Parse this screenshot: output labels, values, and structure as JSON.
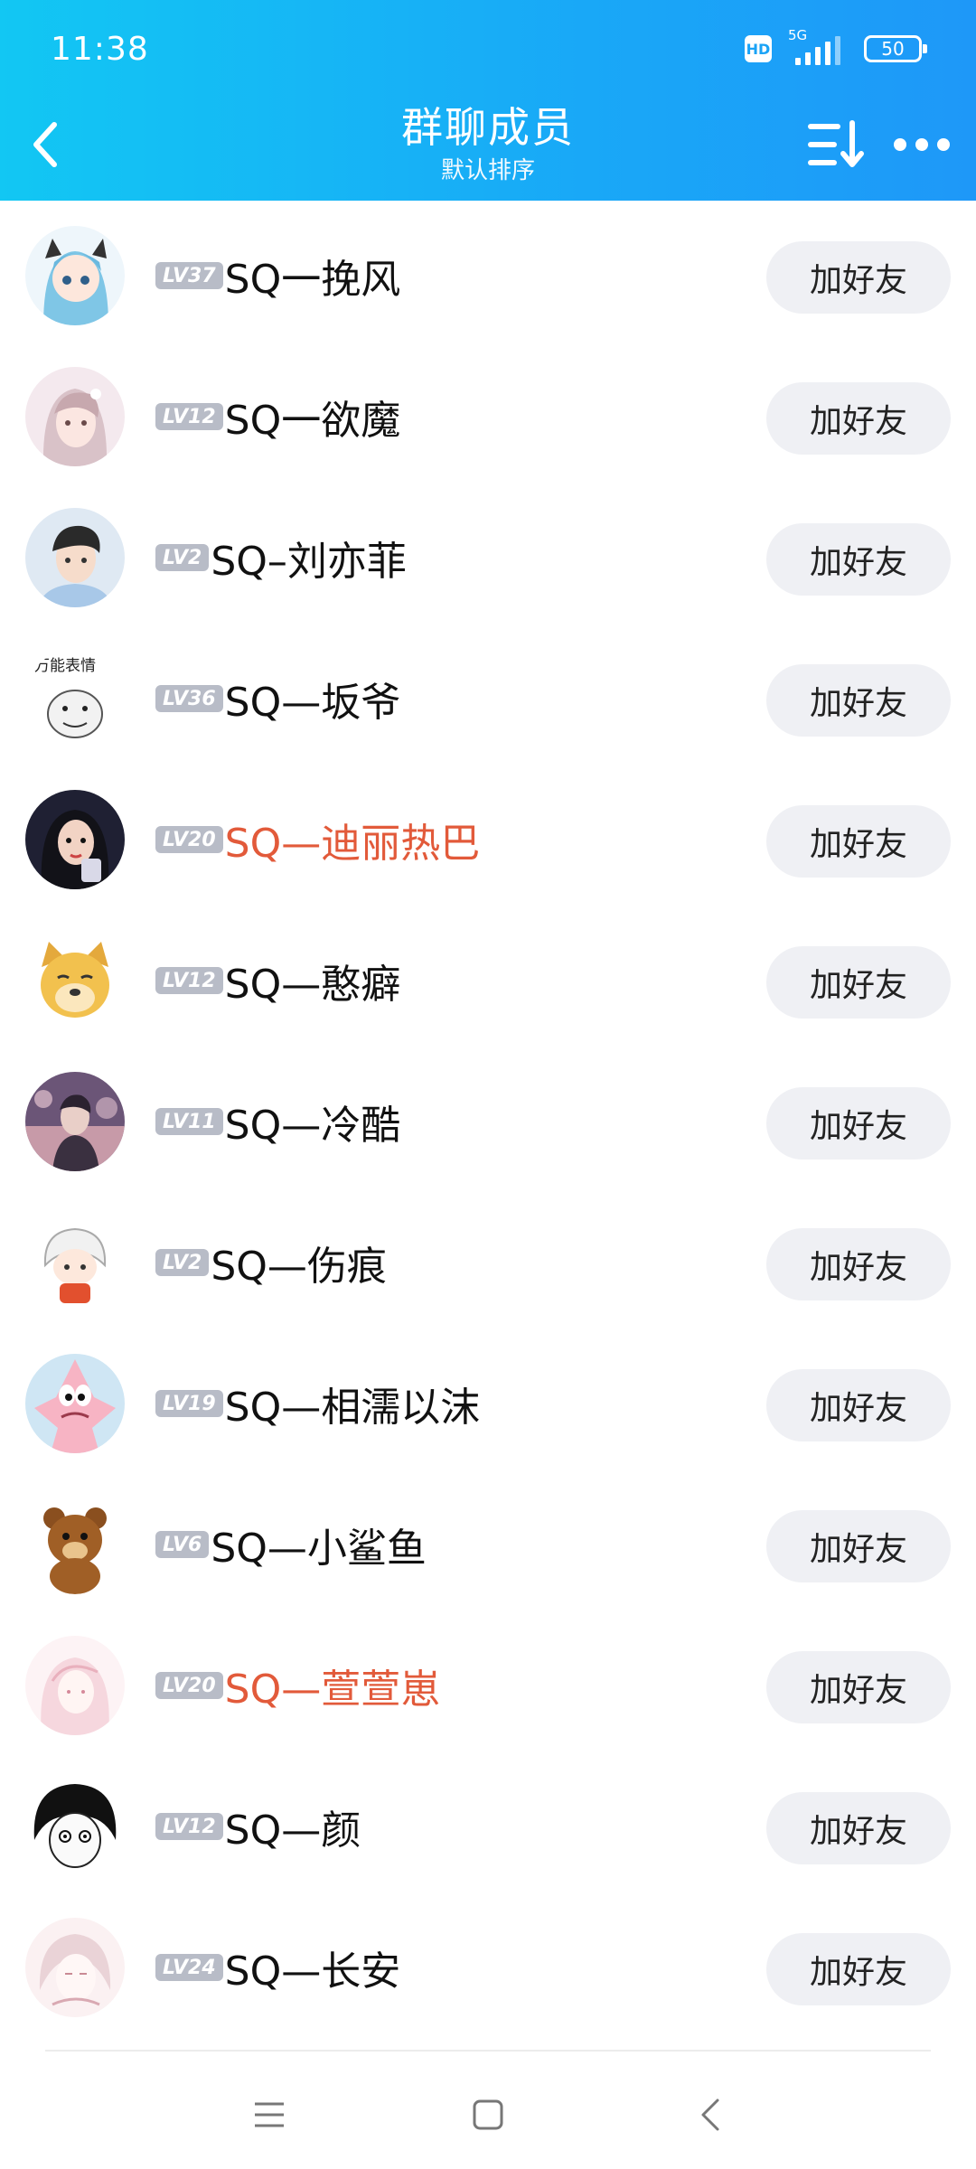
{
  "status_bar": {
    "time": "11:38",
    "hd_label": "HD",
    "network_label": "5G",
    "battery_level": "50"
  },
  "header": {
    "title": "群聊成员",
    "subtitle": "默认排序",
    "back_icon": "chevron-left-icon",
    "sort_icon": "sort-list-icon",
    "more_icon": "more-dots-icon"
  },
  "add_friend_label": "加好友",
  "members": [
    {
      "level": "LV37",
      "name": "SQ一挽风",
      "highlight": false,
      "avatar": "anime-girl-blue-hair"
    },
    {
      "level": "LV12",
      "name": "SQ一欲魔",
      "highlight": false,
      "avatar": "girl-photo"
    },
    {
      "level": "LV2",
      "name": "SQ–刘亦菲",
      "highlight": false,
      "avatar": "boy-photo"
    },
    {
      "level": "LV36",
      "name": "SQ—坂爷",
      "highlight": false,
      "avatar": "meme-face"
    },
    {
      "level": "LV20",
      "name": "SQ—迪丽热巴",
      "highlight": true,
      "avatar": "cartoon-girl-dark"
    },
    {
      "level": "LV12",
      "name": "SQ—憨癖",
      "highlight": false,
      "avatar": "doge"
    },
    {
      "level": "LV11",
      "name": "SQ—冷酷",
      "highlight": false,
      "avatar": "photo-pink"
    },
    {
      "level": "LV2",
      "name": "SQ—伤痕",
      "highlight": false,
      "avatar": "chibi-white-hair"
    },
    {
      "level": "LV19",
      "name": "SQ—相濡以沫",
      "highlight": false,
      "avatar": "patrick-star"
    },
    {
      "level": "LV6",
      "name": "SQ—小鲨鱼",
      "highlight": false,
      "avatar": "bear"
    },
    {
      "level": "LV20",
      "name": "SQ—萱萱崽",
      "highlight": true,
      "avatar": "pink-sketch-girl"
    },
    {
      "level": "LV12",
      "name": "SQ—颜",
      "highlight": false,
      "avatar": "manga-bw"
    },
    {
      "level": "LV24",
      "name": "SQ—长安",
      "highlight": false,
      "avatar": "pink-sketch-boy"
    }
  ],
  "meme_avatar_text": "万能表情",
  "nav": {
    "menu_icon": "menu-icon",
    "home_icon": "home-square-icon",
    "back_icon": "back-triangle-icon"
  },
  "colors": {
    "header_start": "#12c7f3",
    "header_end": "#1e98f8",
    "highlight_name": "#e25a3a",
    "level_badge": "#b8bcc7",
    "add_button_bg": "#eff0f4"
  }
}
